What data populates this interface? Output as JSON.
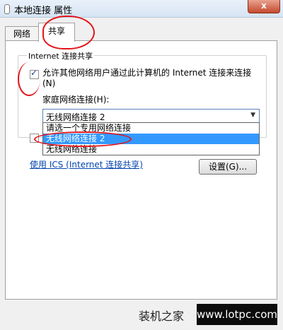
{
  "window": {
    "title": "本地连接 属性",
    "close_label": "x"
  },
  "tabs": [
    {
      "label": "网络"
    },
    {
      "label": "共享"
    }
  ],
  "group": {
    "label": "Internet 连接共享",
    "allow_text": "允许其他网络用户通过此计算机的 Internet 连接来连接(N)",
    "allow_checked": true,
    "home_label": "家庭网络连接(H):",
    "combo_value": "无线网络连接 2",
    "options": [
      "请选一个专用网络连接",
      "无线网络连接 2",
      "无线网络连接"
    ],
    "selected_index": 1
  },
  "link_text": "使用 ICS (Internet 连接共享)",
  "settings_label": "设置(G)...",
  "watermark": {
    "brand": "装机之家",
    "url": "www.lotpc.com"
  },
  "colors": {
    "annotation": "#e4141b",
    "selection": "#3399ff",
    "link": "#0645ad"
  }
}
